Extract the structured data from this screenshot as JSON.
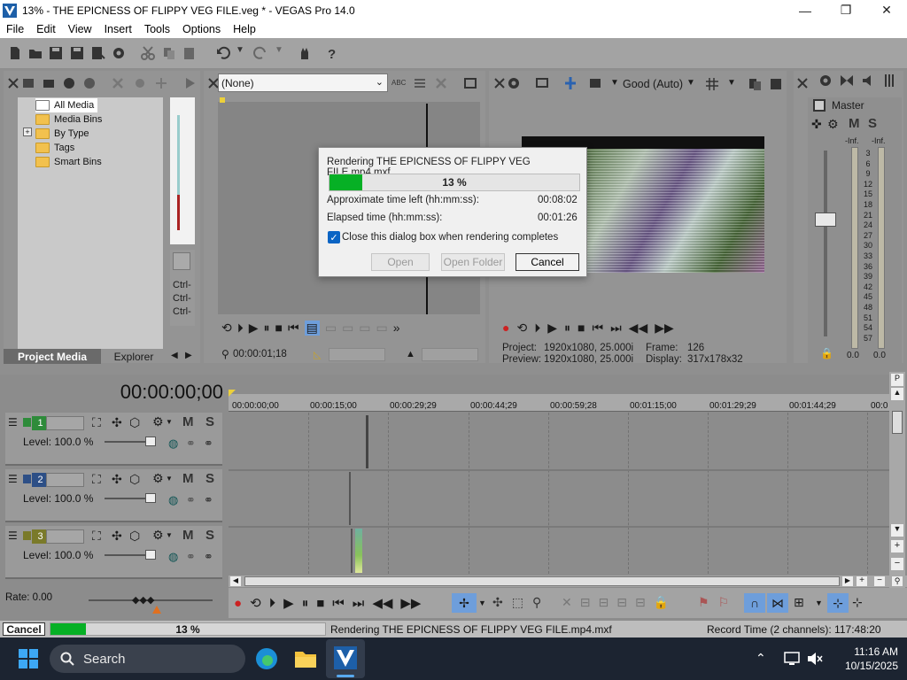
{
  "window": {
    "title": "13% - THE EPICNESS OF FLIPPY VEG FILE.veg * - VEGAS Pro 14.0",
    "minimize": "—",
    "maximize": "❐",
    "close": "✕"
  },
  "menu": [
    "File",
    "Edit",
    "View",
    "Insert",
    "Tools",
    "Options",
    "Help"
  ],
  "project_media": {
    "tree": [
      "All Media",
      "Media Bins",
      "By Type",
      "Tags",
      "Smart Bins"
    ],
    "expand_marker": "+",
    "tabs": {
      "project_media": "Project Media",
      "explorer": "Explorer"
    },
    "side_lines": [
      "Ctrl-",
      "Ctrl-",
      "Ctrl-"
    ]
  },
  "trimmer": {
    "select_value": "(None)",
    "timecode": "00:00:01;18"
  },
  "preview": {
    "quality": "Good (Auto)",
    "project_label": "Project:",
    "project_value": "1920x1080, 25.000i",
    "preview_label": "Preview:",
    "preview_value": "1920x1080, 25.000i",
    "frame_label": "Frame:",
    "frame_value": "126",
    "display_label": "Display:",
    "display_value": "317x178x32"
  },
  "master": {
    "label": "Master",
    "m": "M",
    "s": "S",
    "meter_top": [
      "-Inf.",
      "-Inf."
    ],
    "scale": [
      "3",
      "6",
      "9",
      "12",
      "15",
      "18",
      "21",
      "24",
      "27",
      "30",
      "33",
      "36",
      "39",
      "42",
      "45",
      "48",
      "51",
      "54",
      "57"
    ],
    "bottom_values": [
      "0.0",
      "0.0"
    ]
  },
  "render_dialog": {
    "title": "Rendering THE EPICNESS OF FLIPPY VEG FILE.mp4.mxf",
    "progress_percent": 13,
    "progress_text": "13 %",
    "time_left_label": "Approximate time left (hh:mm:ss):",
    "time_left_value": "00:08:02",
    "elapsed_label": "Elapsed time (hh:mm:ss):",
    "elapsed_value": "00:01:26",
    "checkbox_label": "Close this dialog box when rendering completes",
    "checkbox_checked": true,
    "buttons": {
      "open": "Open",
      "open_folder": "Open Folder",
      "cancel": "Cancel"
    }
  },
  "timeline": {
    "timecode": "00:00:00;00",
    "ruler": [
      "00:00:00;00",
      "00:00:15;00",
      "00:00:29;29",
      "00:00:44;29",
      "00:00:59;28",
      "00:01:15;00",
      "00:01:29;29",
      "00:01:44;29",
      "00:0"
    ],
    "tracks": [
      {
        "number": "1",
        "level": "Level: 100.0 %",
        "color": "#2e8b3a"
      },
      {
        "number": "2",
        "level": "Level: 100.0 %",
        "color": "#2d4f86"
      },
      {
        "number": "3",
        "level": "Level: 100.0 %",
        "color": "#7a7a2a"
      }
    ],
    "m_label": "M",
    "s_label": "S",
    "rate": "Rate: 0.00"
  },
  "statusbar": {
    "cancel": "Cancel",
    "progress_percent": 13,
    "progress_text": "13 %",
    "message": "Rendering THE EPICNESS OF FLIPPY VEG FILE.mp4.mxf",
    "record_time": "Record Time (2 channels): 117:48:20"
  },
  "taskbar": {
    "search": "Search",
    "time": "11:16 AM",
    "date": "10/15/2025"
  },
  "colors": {
    "progress_green": "#06b025",
    "app_bg": "#8f8f8f",
    "taskbar_bg": "#1c2431"
  }
}
